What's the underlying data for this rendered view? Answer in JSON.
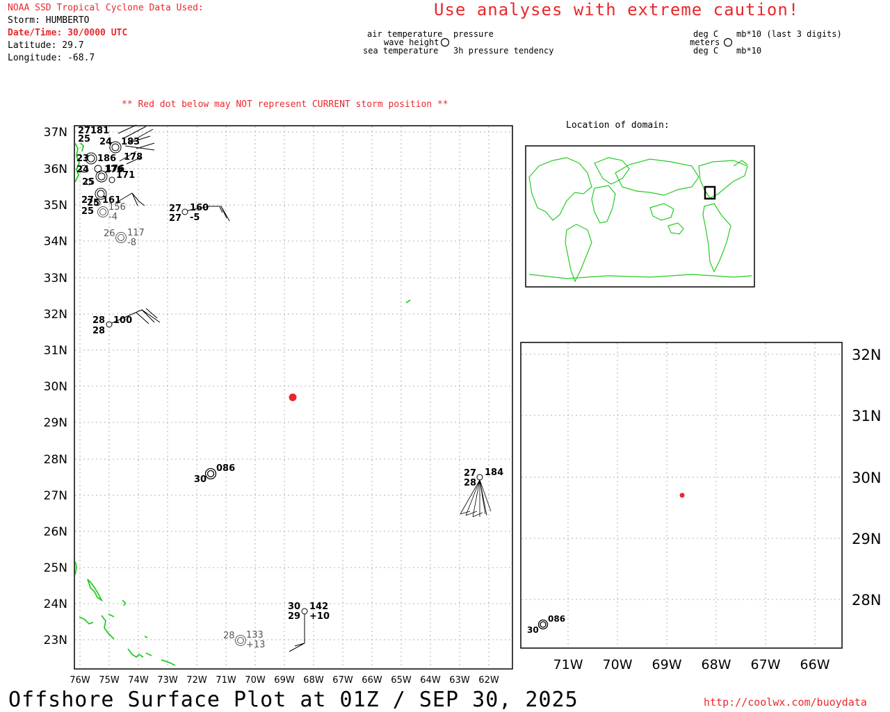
{
  "header": {
    "source": "NOAA SSD Tropical Cyclone Data Used:",
    "storm": "Storm: HUMBERTO",
    "datetime": "Date/Time: 30/0000 UTC",
    "latitude": "Latitude: 29.7",
    "longitude": "Longitude: -68.7"
  },
  "warning": "Use analyses with extreme caution!",
  "key": {
    "air_temperature": "air temperature",
    "wave_height": "wave height",
    "sea_temperature": "sea temperature",
    "pressure": "pressure",
    "pressure_tendency": "3h pressure tendency",
    "unit_air": "deg C",
    "unit_wave": "meters",
    "unit_sea": "deg C",
    "unit_pressure": "mb*10 (last 3 digits)",
    "unit_tendency": "mb*10"
  },
  "red_dot_note": "** Red dot below may NOT represent CURRENT storm position **",
  "location_label": "Location of domain:",
  "main_map": {
    "lat_labels": [
      "37N",
      "36N",
      "35N",
      "34N",
      "33N",
      "32N",
      "31N",
      "30N",
      "29N",
      "28N",
      "27N",
      "26N",
      "25N",
      "24N",
      "23N"
    ],
    "lon_labels": [
      "76W",
      "75W",
      "74W",
      "73W",
      "72W",
      "71W",
      "70W",
      "69W",
      "68W",
      "67W",
      "66W",
      "65W",
      "64W",
      "63W",
      "62W"
    ],
    "storm_position": {
      "lat": 29.7,
      "lon": -68.7
    },
    "stations": [
      {
        "air": "27",
        "sea": "27",
        "pressure": "160",
        "tendency": "-5"
      },
      {
        "air": "26",
        "sea": "",
        "pressure": "117",
        "tendency": "-8"
      },
      {
        "air": "25",
        "sea": "",
        "pressure": "156",
        "tendency": "-4"
      },
      {
        "air": "27",
        "sea": "25",
        "pressure": "161",
        "tendency": ""
      },
      {
        "air": "28",
        "sea": "28",
        "pressure": "100",
        "tendency": ""
      },
      {
        "air": "30",
        "sea": "",
        "pressure": "086",
        "tendency": ""
      },
      {
        "air": "27",
        "sea": "28",
        "pressure": "184",
        "tendency": ""
      },
      {
        "air": "30",
        "sea": "29",
        "pressure": "142",
        "tendency": "+10"
      },
      {
        "air": "28",
        "sea": "",
        "pressure": "133",
        "tendency": "+13"
      },
      {
        "air": "",
        "sea": "",
        "pressure": "171",
        "tendency": ""
      },
      {
        "air": "",
        "sea": "",
        "pressure": "176",
        "tendency": ""
      },
      {
        "air": "",
        "sea": "",
        "pressure": "178",
        "tendency": ""
      },
      {
        "air": "",
        "sea": "",
        "pressure": "183",
        "tendency": ""
      }
    ]
  },
  "zoom_map": {
    "lat_labels": [
      "32N",
      "31N",
      "30N",
      "29N",
      "28N"
    ],
    "lon_labels": [
      "71W",
      "70W",
      "69W",
      "68W",
      "67W",
      "66W"
    ],
    "station": {
      "air": "30",
      "pressure": "086"
    }
  },
  "colors": {
    "land": "#22cc22",
    "storm": "#e8282c",
    "warning": "#e8282c",
    "grid": "#b0b0b0"
  },
  "footer": {
    "title": "Offshore Surface Plot at 01Z / SEP 30, 2025",
    "url": "http://coolwx.com/buoydata"
  }
}
